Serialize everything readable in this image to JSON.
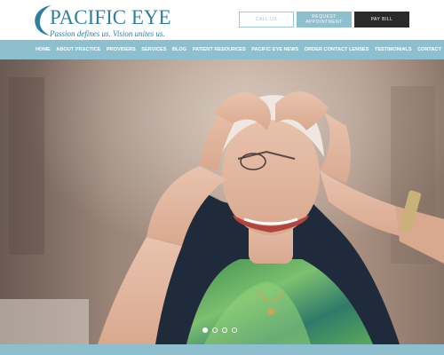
{
  "brand": {
    "name": "PACIFIC EYE",
    "tagline": "Passion defines us. Vision unites us.",
    "color": "#2f7f9e"
  },
  "header_buttons": {
    "call": "CALL US",
    "request_line1": "REQUEST",
    "request_line2": "APPOINTMENT",
    "pay": "PAY BILL"
  },
  "nav": {
    "items": [
      "HOME",
      "ABOUT PRACTICE",
      "PROVIDERS",
      "SERVICES",
      "BLOG",
      "PATIENT RESOURCES",
      "PACIFIC EYE NEWS",
      "ORDER CONTACT LENSES",
      "TESTIMONIALS",
      "CONTACT"
    ],
    "color": "#8dbfcf"
  },
  "hero": {
    "slide_count": 4,
    "active_slide": 1
  }
}
